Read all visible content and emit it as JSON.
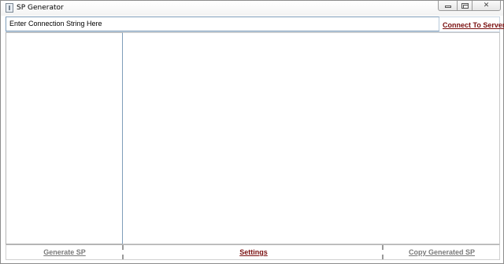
{
  "window": {
    "title": "SP Generator",
    "controls": {
      "minimize": "minimize-icon",
      "maximize": "maximize-icon",
      "close": "✕"
    }
  },
  "connection": {
    "placeholder": "Enter Connection String Here",
    "value": "Enter Connection String Here",
    "connect_label": "Connect To Server"
  },
  "footer": {
    "generate_label": "Generate SP",
    "settings_label": "Settings",
    "copy_label": "Copy Generated SP"
  },
  "colors": {
    "link_active": "#7a1010",
    "link_disabled": "#7a7a7a",
    "input_border": "#7f9db9"
  }
}
